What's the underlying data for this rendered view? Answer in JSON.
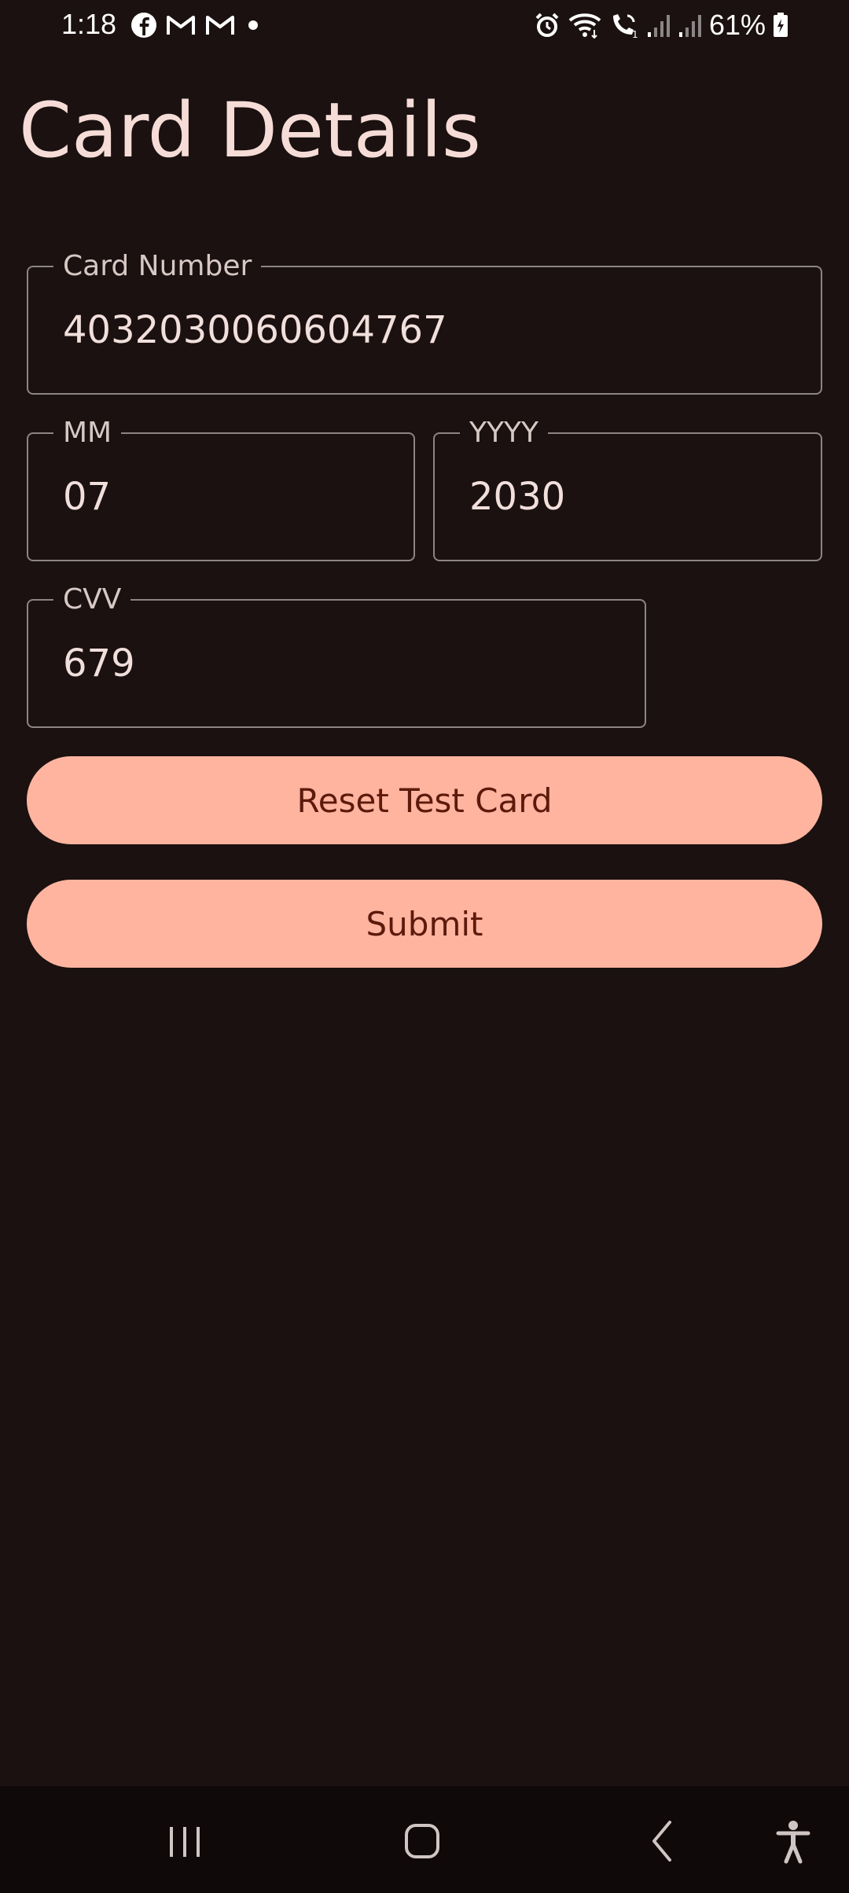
{
  "status_bar": {
    "time": "1:18",
    "notification_icons": [
      "facebook-icon",
      "gmail-icon",
      "gmail-icon",
      "dot-icon"
    ],
    "system_icons": [
      "alarm-icon",
      "wifi-icon",
      "wifi-call-icon",
      "signal-icon",
      "signal-icon"
    ],
    "battery": "61%"
  },
  "page": {
    "title": "Card Details"
  },
  "form": {
    "card_number": {
      "label": "Card Number",
      "value": "4032030060604767"
    },
    "month": {
      "label": "MM",
      "value": "07"
    },
    "year": {
      "label": "YYYY",
      "value": "2030"
    },
    "cvv": {
      "label": "CVV",
      "value": "679"
    }
  },
  "buttons": {
    "reset_label": "Reset Test Card",
    "submit_label": "Submit"
  },
  "nav": {
    "items": [
      "recents-icon",
      "home-icon",
      "back-icon",
      "accessibility-icon"
    ]
  },
  "colors": {
    "background": "#1a1110",
    "accent": "#ffb4a0",
    "accent_text": "#5d1a0b",
    "outline": "#8d8583"
  }
}
